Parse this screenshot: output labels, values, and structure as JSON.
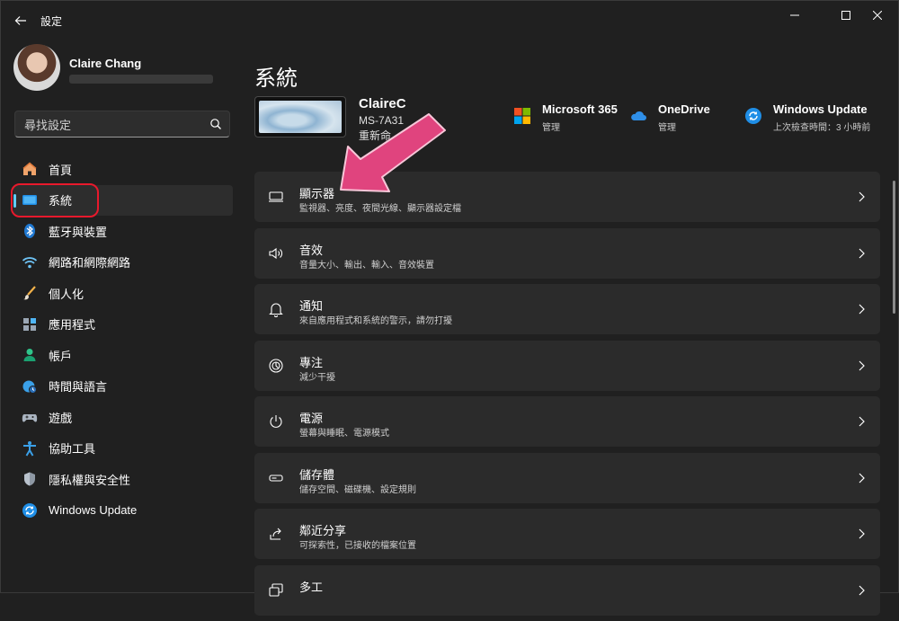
{
  "app": {
    "title": "設定"
  },
  "profile": {
    "name": "Claire Chang"
  },
  "search": {
    "placeholder": "尋找設定"
  },
  "nav": {
    "items": [
      {
        "label": "首頁"
      },
      {
        "label": "系統"
      },
      {
        "label": "藍牙與裝置"
      },
      {
        "label": "網路和網際網路"
      },
      {
        "label": "個人化"
      },
      {
        "label": "應用程式"
      },
      {
        "label": "帳戶"
      },
      {
        "label": "時間與語言"
      },
      {
        "label": "遊戲"
      },
      {
        "label": "協助工具"
      },
      {
        "label": "隱私權與安全性"
      },
      {
        "label": "Windows Update"
      }
    ],
    "active": "系統"
  },
  "main": {
    "title": "系統",
    "device": {
      "name": "ClaireC",
      "model": "MS-7A31",
      "rename": "重新命"
    },
    "quick": [
      {
        "title": "Microsoft 365",
        "subtitle": "管理"
      },
      {
        "title": "OneDrive",
        "subtitle": "管理"
      },
      {
        "title": "Windows Update",
        "subtitle": "上次檢查時間：3 小時前"
      }
    ],
    "cards": [
      {
        "title": "顯示器",
        "subtitle": "監視器、亮度、夜間光線、顯示器設定檔"
      },
      {
        "title": "音效",
        "subtitle": "音量大小、輸出、輸入、音效裝置"
      },
      {
        "title": "通知",
        "subtitle": "來自應用程式和系統的警示，請勿打擾"
      },
      {
        "title": "專注",
        "subtitle": "減少干擾"
      },
      {
        "title": "電源",
        "subtitle": "螢幕與睡眠、電源模式"
      },
      {
        "title": "儲存體",
        "subtitle": "儲存空間、磁碟機、設定規則"
      },
      {
        "title": "鄰近分享",
        "subtitle": "可探索性，已接收的檔案位置"
      },
      {
        "title": "多工",
        "subtitle": ""
      }
    ]
  },
  "colors": {
    "accent": "#60cdff",
    "highlight": "#e8192c",
    "arrow": "#e0447e",
    "card": "#2b2b2b",
    "background": "#202020"
  },
  "icons": {
    "nav": [
      "home-icon",
      "system-icon",
      "bluetooth-icon",
      "network-icon",
      "personalization-icon",
      "apps-icon",
      "accounts-icon",
      "time-language-icon",
      "gaming-icon",
      "accessibility-icon",
      "privacy-icon",
      "windows-update-icon"
    ],
    "cards": [
      "display-icon",
      "sound-icon",
      "notification-icon",
      "focus-icon",
      "power-icon",
      "storage-icon",
      "nearby-share-icon",
      "multitasking-icon"
    ]
  }
}
